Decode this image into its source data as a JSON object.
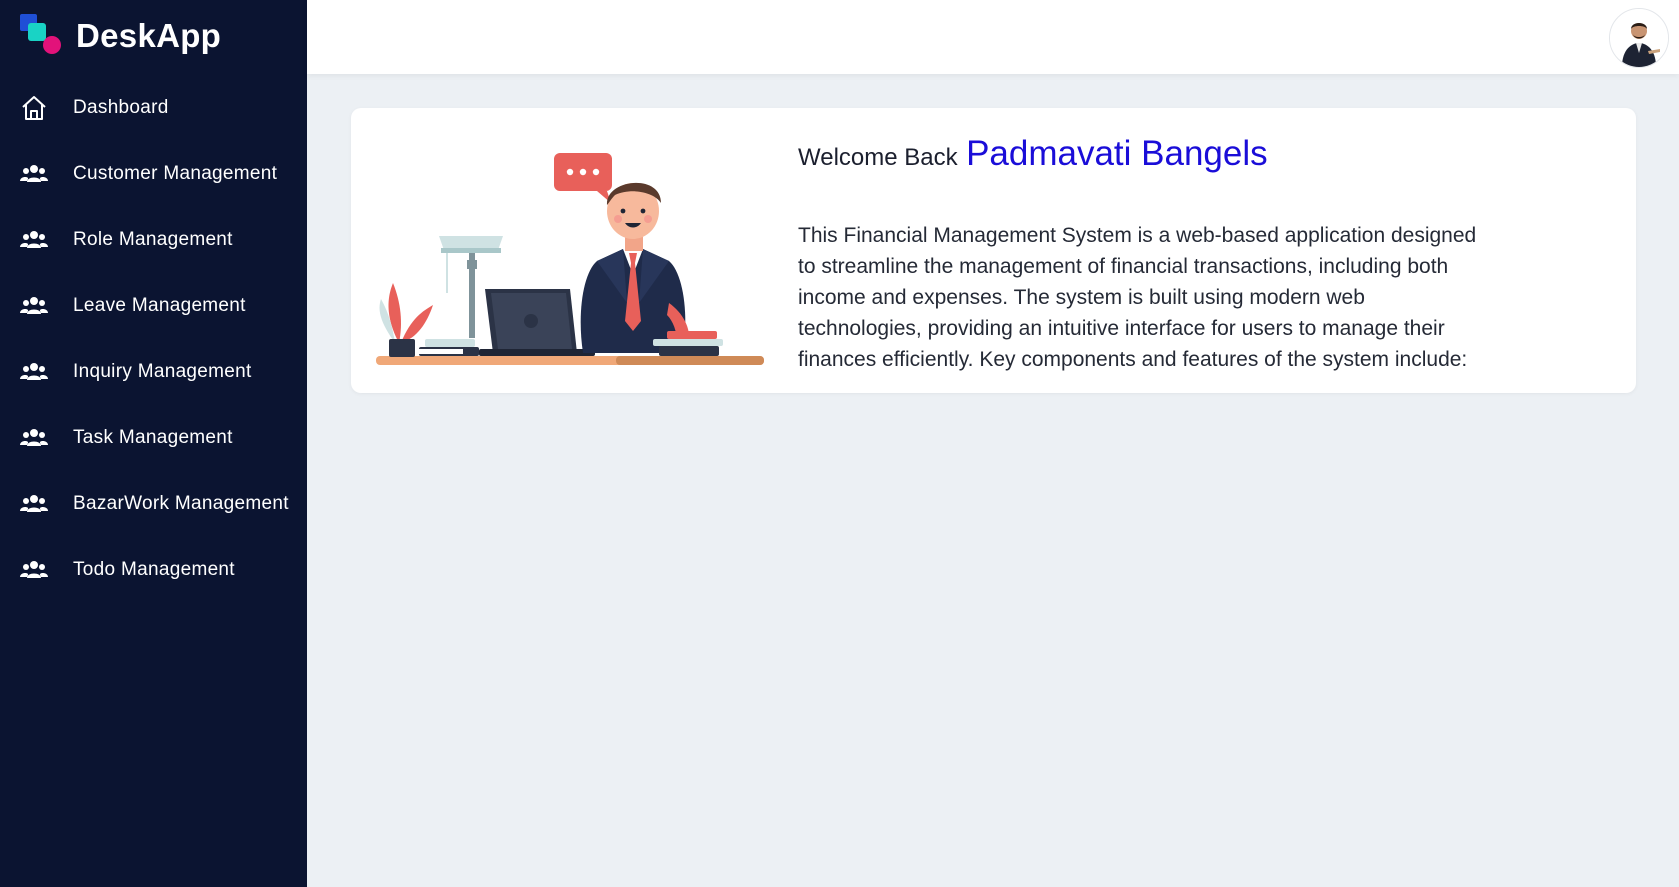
{
  "brand": {
    "name": "DeskApp"
  },
  "sidebar": {
    "items": [
      {
        "label": "Dashboard",
        "icon": "home-icon"
      },
      {
        "label": "Customer Management",
        "icon": "users-icon"
      },
      {
        "label": "Role Management",
        "icon": "users-icon"
      },
      {
        "label": "Leave Management",
        "icon": "users-icon"
      },
      {
        "label": "Inquiry Management",
        "icon": "users-icon"
      },
      {
        "label": "Task Management",
        "icon": "users-icon"
      },
      {
        "label": "BazarWork Management",
        "icon": "users-icon"
      },
      {
        "label": "Todo Management",
        "icon": "users-icon"
      }
    ]
  },
  "welcome": {
    "prefix": "Welcome Back",
    "name": "Padmavati Bangels",
    "description": "This Financial Management System is a web-based application designed to streamline the management of financial transactions, including both income and expenses. The system is built using modern web technologies, providing an intuitive interface for users to manage their finances efficiently. Key components and features of the system include:"
  },
  "colors": {
    "sidebar_bg": "#0b1431",
    "accent_name": "#1a0dd8",
    "page_bg": "#ecf0f4"
  }
}
